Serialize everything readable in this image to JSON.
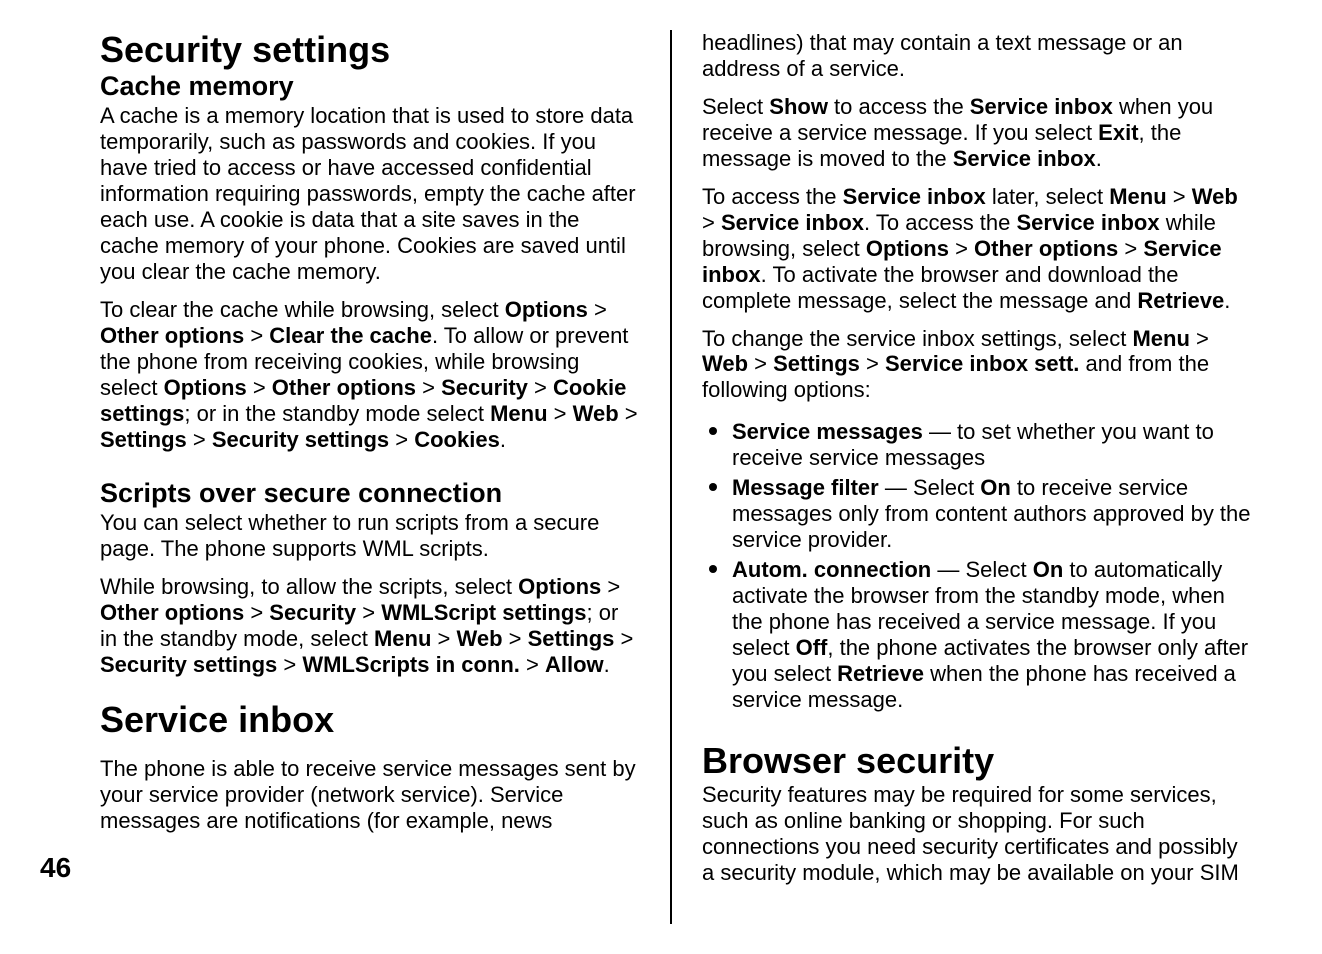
{
  "page_number": "46",
  "left_column": {
    "h1_security": "Security settings",
    "h2_cache": "Cache memory",
    "p_cache_intro": "A cache is a memory location that is used to store data temporarily, such as passwords and cookies. If you have tried to access or have accessed confidential information requiring passwords, empty the cache after each use. A cookie is data that a site saves in the cache memory of your phone. Cookies are saved until you clear the cache memory.",
    "p_clear_cache_1": "To clear the cache while browsing, select ",
    "p_clear_cache_options": "Options",
    "p_clear_cache_gt1": " > ",
    "p_clear_cache_other": "Other options",
    "p_clear_cache_gt2": " > ",
    "p_clear_cache_clear": "Clear the cache",
    "p_clear_cache_2": ". To allow or prevent the phone from receiving cookies, while browsing select ",
    "p_clear_cache_options2": "Options",
    "p_clear_cache_gt3": " > ",
    "p_clear_cache_other2": "Other options",
    "p_clear_cache_gt4": " > ",
    "p_clear_cache_security": "Security",
    "p_clear_cache_gt5": " > ",
    "p_clear_cache_cookie": "Cookie settings",
    "p_clear_cache_3": "; or in the standby mode select ",
    "p_clear_cache_menu": "Menu",
    "p_clear_cache_gt6": " > ",
    "p_clear_cache_web": "Web",
    "p_clear_cache_gt7": " > ",
    "p_clear_cache_settings": "Settings",
    "p_clear_cache_gt8": " > ",
    "p_clear_cache_secset": "Security settings",
    "p_clear_cache_gt9": " > ",
    "p_clear_cache_cookies": "Cookies",
    "p_clear_cache_4": ".",
    "h2_scripts": "Scripts over secure connection",
    "p_scripts_intro": "You can select whether to run scripts from a secure page. The phone supports WML scripts.",
    "p_scripts_1": "While browsing, to allow the scripts, select ",
    "p_scripts_options": "Options",
    "p_scripts_gt1": " > ",
    "p_scripts_other": "Other options",
    "p_scripts_gt2": " > ",
    "p_scripts_security": "Security",
    "p_scripts_gt3": " > ",
    "p_scripts_wml": "WMLScript settings",
    "p_scripts_2": "; or in the standby mode, select ",
    "p_scripts_menu": "Menu",
    "p_scripts_gt4": " > ",
    "p_scripts_web": "Web",
    "p_scripts_gt5": " > ",
    "p_scripts_settings": "Settings",
    "p_scripts_gt6": " > ",
    "p_scripts_secset": "Security settings",
    "p_scripts_gt7": " > ",
    "p_scripts_wmlconn": "WMLScripts in conn.",
    "p_scripts_gt8": " > ",
    "p_scripts_allow": "Allow",
    "p_scripts_3": ".",
    "h1_service": "Service inbox",
    "p_service_intro": "The phone is able to receive service messages sent by your service provider (network service). Service messages are notifications (for example, news"
  },
  "right_column": {
    "p_cont": "headlines) that may contain a text message or an address of a service.",
    "p_show_1": "Select ",
    "p_show_show": "Show",
    "p_show_2": " to access the ",
    "p_show_si1": "Service inbox",
    "p_show_3": " when you receive a service message. If you select ",
    "p_show_exit": "Exit",
    "p_show_4": ", the message is moved to the ",
    "p_show_si2": "Service inbox",
    "p_show_5": ".",
    "p_access_1": "To access the ",
    "p_access_si1": "Service inbox",
    "p_access_2": " later, select ",
    "p_access_menu": "Menu",
    "p_access_gt1": " > ",
    "p_access_web": "Web",
    "p_access_gt2": " > ",
    "p_access_si2": "Service inbox",
    "p_access_3": ". To access the ",
    "p_access_si3": "Service inbox",
    "p_access_4": " while browsing, select ",
    "p_access_options": "Options",
    "p_access_gt3": " > ",
    "p_access_other": "Other options",
    "p_access_gt4": " > ",
    "p_access_si4": "Service inbox",
    "p_access_5": ". To activate the browser and download the complete message, select the message and ",
    "p_access_retrieve": "Retrieve",
    "p_access_6": ".",
    "p_change_1": "To change the service inbox settings, select ",
    "p_change_menu": "Menu",
    "p_change_gt1": " > ",
    "p_change_web": "Web",
    "p_change_gt2": " > ",
    "p_change_settings": "Settings",
    "p_change_gt3": " > ",
    "p_change_sis": "Service inbox sett.",
    "p_change_2": " and from the following options:",
    "li1_bold": "Service messages",
    "li1_text": " — to set whether you want to receive service messages",
    "li2_bold": "Message filter",
    "li2_text1": " — Select ",
    "li2_on": "On",
    "li2_text2": " to receive service messages only from content authors approved by the service provider.",
    "li3_bold": "Autom. connection",
    "li3_text1": " — Select ",
    "li3_on": "On",
    "li3_text2": " to automatically activate the browser from the standby mode, when the phone has received a service message. If you select ",
    "li3_off": "Off",
    "li3_text3": ", the phone activates the browser only after you select ",
    "li3_retrieve": "Retrieve",
    "li3_text4": " when the phone has received a service message.",
    "h1_browser": "Browser security",
    "p_browser_intro": "Security features may be required for some services, such as online banking or shopping. For such connections you need security certificates and possibly a security module, which may be available on your SIM"
  }
}
